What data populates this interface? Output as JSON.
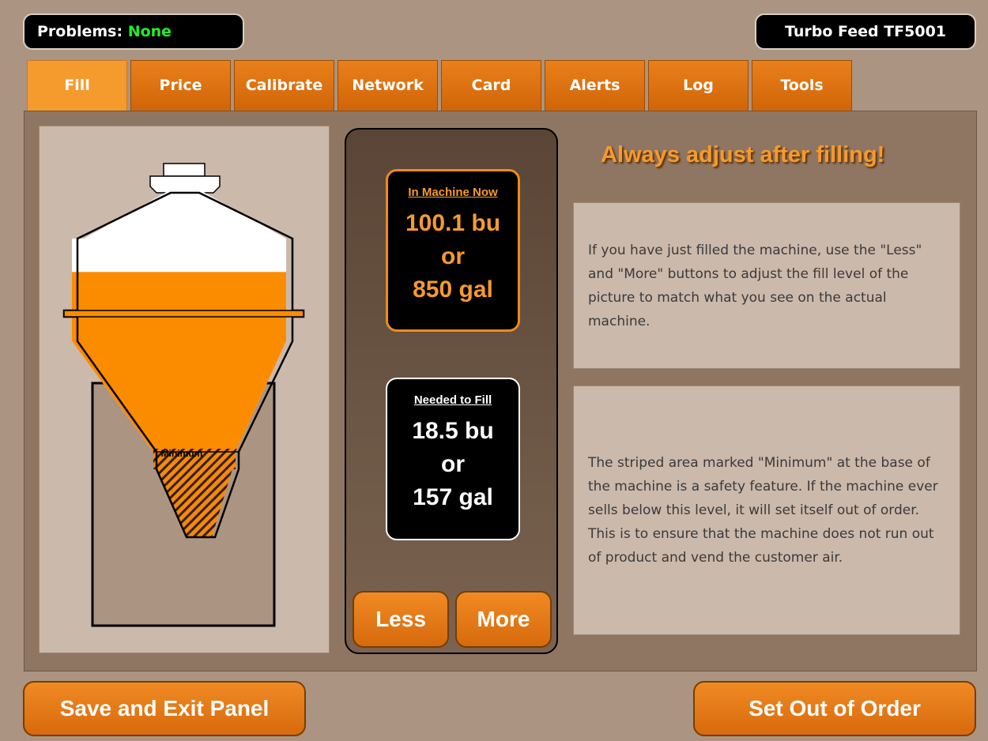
{
  "status": {
    "problems_label": "Problems:",
    "problems_value": "None",
    "model": "Turbo Feed TF5001"
  },
  "tabs": [
    {
      "label": "Fill",
      "active": true
    },
    {
      "label": "Price"
    },
    {
      "label": "Calibrate"
    },
    {
      "label": "Network"
    },
    {
      "label": "Card"
    },
    {
      "label": "Alerts"
    },
    {
      "label": "Log"
    },
    {
      "label": "Tools"
    }
  ],
  "hopper": {
    "minimum_label": "Minimum",
    "fill_level": 0.77
  },
  "in_machine": {
    "title": "In Machine Now",
    "bu": "100.1 bu",
    "or": "or",
    "gal": "850 gal"
  },
  "needed": {
    "title": "Needed to Fill",
    "bu": "18.5 bu",
    "or": "or",
    "gal": "157 gal"
  },
  "buttons": {
    "less": "Less",
    "more": "More",
    "save_exit": "Save and Exit Panel",
    "out_of_order": "Set Out of Order"
  },
  "warning": "Always adjust after filling!",
  "help": {
    "text1": "If you have just filled the machine, use the \"Less\" and \"More\" buttons to adjust the fill level of the picture to match what you see on the actual machine.",
    "text2": "The striped area marked \"Minimum\" at the base of the machine is a safety feature. If the machine ever sells below this level, it will set itself out of order. This is to ensure that the machine does not run out of product and vend the customer air."
  },
  "colors": {
    "accent": "#f08a1c",
    "ok": "#22ee22",
    "background": "#ab9481"
  }
}
